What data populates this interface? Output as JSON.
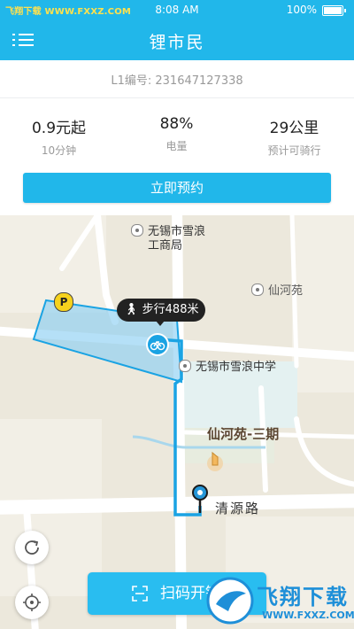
{
  "status_bar": {
    "watermark_prefix": "飞翔下载",
    "watermark_url": "WWW.FXXZ.COM",
    "time": "8:08 AM",
    "battery": "100%"
  },
  "header": {
    "title": "锂市民",
    "menu_icon": "menu-icon"
  },
  "bike": {
    "code_label": "L1编号",
    "code_separator": ":",
    "code": "231647127338"
  },
  "stats": [
    {
      "value": "0.9元起",
      "label": "10分钟"
    },
    {
      "value": "88%",
      "label": "电量"
    },
    {
      "value": "29公里",
      "label": "预计可骑行"
    }
  ],
  "actions": {
    "reserve_label": "立即预约",
    "scan_label": "扫码开锁",
    "scan_icon": "scan-icon",
    "refresh_icon": "refresh-icon",
    "locate_icon": "locate-icon"
  },
  "map": {
    "walk_label": "步行488米",
    "parking_label": "P",
    "places": {
      "bureau_line1": "无锡市雪浪",
      "bureau_line2": "工商局",
      "xianheyuan": "仙河苑",
      "school": "无锡市雪浪中学",
      "phase3": "仙河苑-三期",
      "road": "清源路"
    }
  },
  "watermark_footer": {
    "brand": "飞翔下载",
    "url": "WWW.FXXZ.COM"
  },
  "colors": {
    "primary": "#21b7ea",
    "route": "#1aa3e3",
    "map_bg": "#ece8dc"
  }
}
